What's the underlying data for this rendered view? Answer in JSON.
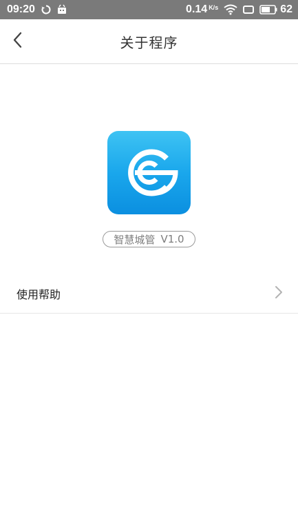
{
  "status_bar": {
    "time": "09:20",
    "speed": "0.14",
    "speed_unit": "K/s",
    "battery": "62",
    "icons": [
      "sync-icon",
      "android-icon",
      "wifi-icon",
      "screen-icon",
      "battery-icon"
    ]
  },
  "header": {
    "title": "关于程序",
    "back_icon": "chevron-left-icon"
  },
  "app": {
    "logo_icon": "app-logo-icon",
    "name": "智慧城管",
    "version": "V1.0",
    "brand_color": "#1aa7ec"
  },
  "menu": {
    "items": [
      {
        "label": "使用帮助",
        "icon": "chevron-right-icon"
      }
    ]
  }
}
